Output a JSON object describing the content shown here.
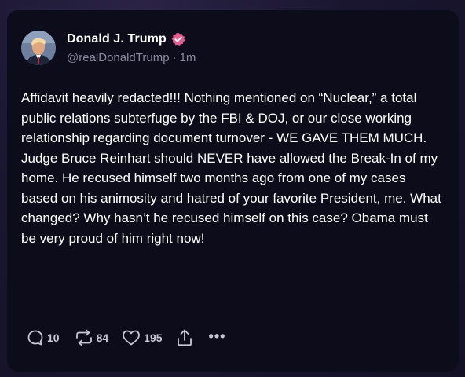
{
  "post": {
    "author": {
      "display_name": "Donald J. Trump",
      "handle": "@realDonaldTrump",
      "verified": true,
      "verified_color": "#e35d8f"
    },
    "time_ago": "1m",
    "separator": "·",
    "text": "Affidavit heavily redacted!!! Nothing mentioned on “Nuclear,” a total public relations subterfuge by the FBI & DOJ, or our close working relationship regarding document turnover - WE GAVE THEM MUCH. Judge Bruce Reinhart should NEVER have allowed the Break-In of my home. He recused himself two months ago from one of my cases based on his animosity and hatred of your favorite President, me. What changed? Why hasn’t he recused himself on this case? Obama must be very proud of him right now!",
    "actions": {
      "replies": "10",
      "retruths": "84",
      "likes": "195",
      "more": "•••"
    }
  },
  "icons": {
    "verified": "verified-badge-icon",
    "reply": "reply-icon",
    "retruth": "retruth-icon",
    "like": "heart-icon",
    "share": "share-icon",
    "more": "more-icon"
  }
}
